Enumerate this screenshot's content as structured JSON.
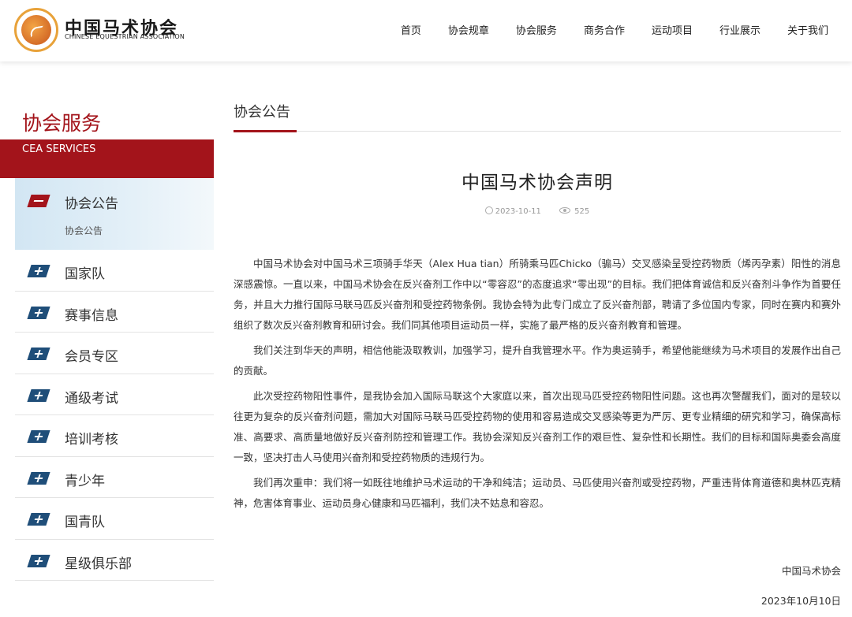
{
  "brand": {
    "name_cn": "中国马术协会",
    "name_en": "CHINESE EQUESTRIAN ASSOCIATION"
  },
  "nav": [
    "首页",
    "协会规章",
    "协会服务",
    "商务合作",
    "运动项目",
    "行业展示",
    "关于我们"
  ],
  "sidebar": {
    "title": "协会服务",
    "subtitle": "CEA SERVICES",
    "active": {
      "label": "协会公告",
      "sub": "协会公告"
    },
    "items": [
      "国家队",
      "赛事信息",
      "会员专区",
      "通级考试",
      "培训考核",
      "青少年",
      "国青队",
      "星级俱乐部"
    ]
  },
  "main": {
    "section_title": "协会公告",
    "article": {
      "title": "中国马术协会声明",
      "date": "2023-10-11",
      "views": "525",
      "paragraphs": [
        "中国马术协会对中国马术三项骑手华天（Alex Hua tian）所骑乘马匹Chicko（骟马）交叉感染呈受控药物质（烯丙孕素）阳性的消息深感震惊。一直以来，中国马术协会在反兴奋剂工作中以“零容忍”的态度追求“零出现”的目标。我们把体育诚信和反兴奋剂斗争作为首要任务，并且大力推行国际马联马匹反兴奋剂和受控药物条例。我协会特为此专门成立了反兴奋剂部，聘请了多位国内专家，同时在赛内和赛外组织了数次反兴奋剂教育和研讨会。我们同其他项目运动员一样，实施了最严格的反兴奋剂教育和管理。",
        "我们关注到华天的声明，相信他能汲取教训，加强学习，提升自我管理水平。作为奥运骑手，希望他能继续为马术项目的发展作出自己的贡献。",
        "此次受控药物阳性事件，是我协会加入国际马联这个大家庭以来，首次出现马匹受控药物阳性问题。这也再次警醒我们，面对的是较以往更为复杂的反兴奋剂问题，需加大对国际马联马匹受控药物的使用和容易造成交叉感染等更为严厉、更专业精细的研究和学习，确保高标准、高要求、高质量地做好反兴奋剂防控和管理工作。我协会深知反兴奋剂工作的艰巨性、复杂性和长期性。我们的目标和国际奥委会高度一致，坚决打击人马使用兴奋剂和受控药物质的违规行为。",
        "我们再次重申：我们将一如既往地维护马术运动的干净和纯洁；运动员、马匹使用兴奋剂或受控药物，严重违背体育道德和奥林匹克精神，危害体育事业、运动员身心健康和马匹福利，我们决不姑息和容忍。"
      ],
      "signature": "中国马术协会",
      "signed_date": "2023年10月10日"
    }
  },
  "colors": {
    "accent": "#a3141b",
    "icon_blue": "#1f4e79"
  }
}
